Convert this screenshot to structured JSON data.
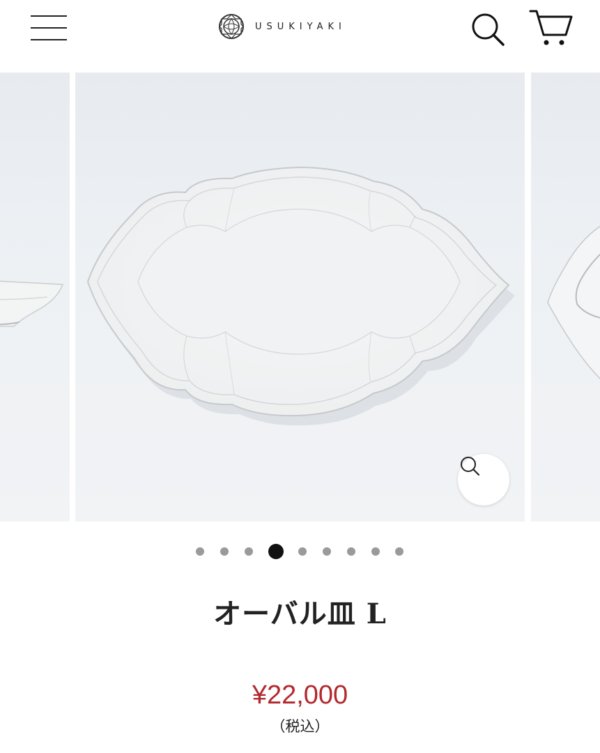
{
  "header": {
    "logo_text": "USUKIYAKI",
    "icons": {
      "menu": "hamburger-menu-icon",
      "logo": "usukiyaki-logo-mark",
      "search": "search-icon",
      "cart": "cart-icon",
      "zoom": "zoom-icon"
    }
  },
  "carousel": {
    "slide_count": 9,
    "active_index": 3
  },
  "product": {
    "title": "オーバル皿 L",
    "price": "¥22,000",
    "tax_note": "（税込）"
  },
  "colors": {
    "price": "#b3282d",
    "active_dot": "#111111",
    "inactive_dot": "#9a9a9a"
  }
}
